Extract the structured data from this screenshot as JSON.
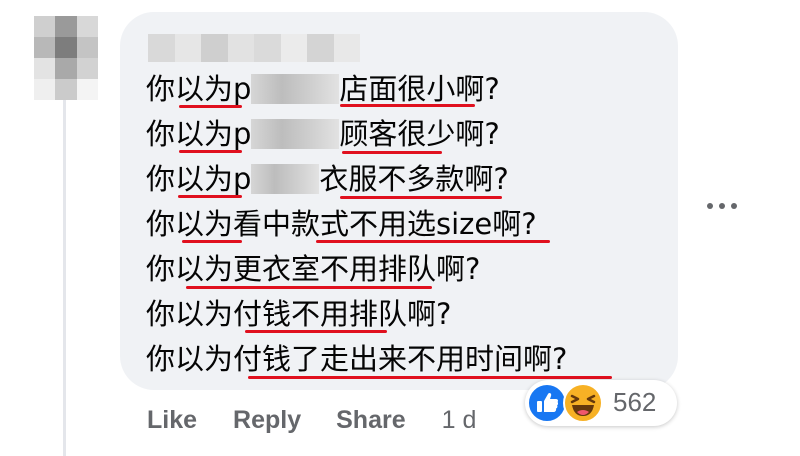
{
  "comment": {
    "lines": [
      {
        "pre": "你以为p",
        "post": "店面很小啊?"
      },
      {
        "pre": "你以为p",
        "post": "顾客很少啊?"
      },
      {
        "pre": "你以为p",
        "post": "衣服不多款啊?"
      },
      {
        "text": "你以为看中款式不用选size啊?"
      },
      {
        "text": "你以为更衣室不用排队啊?"
      },
      {
        "text": "你以为付钱不用排队啊?"
      },
      {
        "text": "你以为付钱了走出来不用时间啊?"
      }
    ]
  },
  "actions": {
    "like": "Like",
    "reply": "Reply",
    "share": "Share",
    "timestamp": "1 d"
  },
  "reactions": {
    "count": "562",
    "icons": [
      "like-icon",
      "haha-icon"
    ]
  },
  "colors": {
    "bubble": "#f0f2f5",
    "underline": "#e0101e",
    "like_blue": "#1877f2",
    "haha_yellow": "#f7b125",
    "meta_text": "#65676b"
  }
}
